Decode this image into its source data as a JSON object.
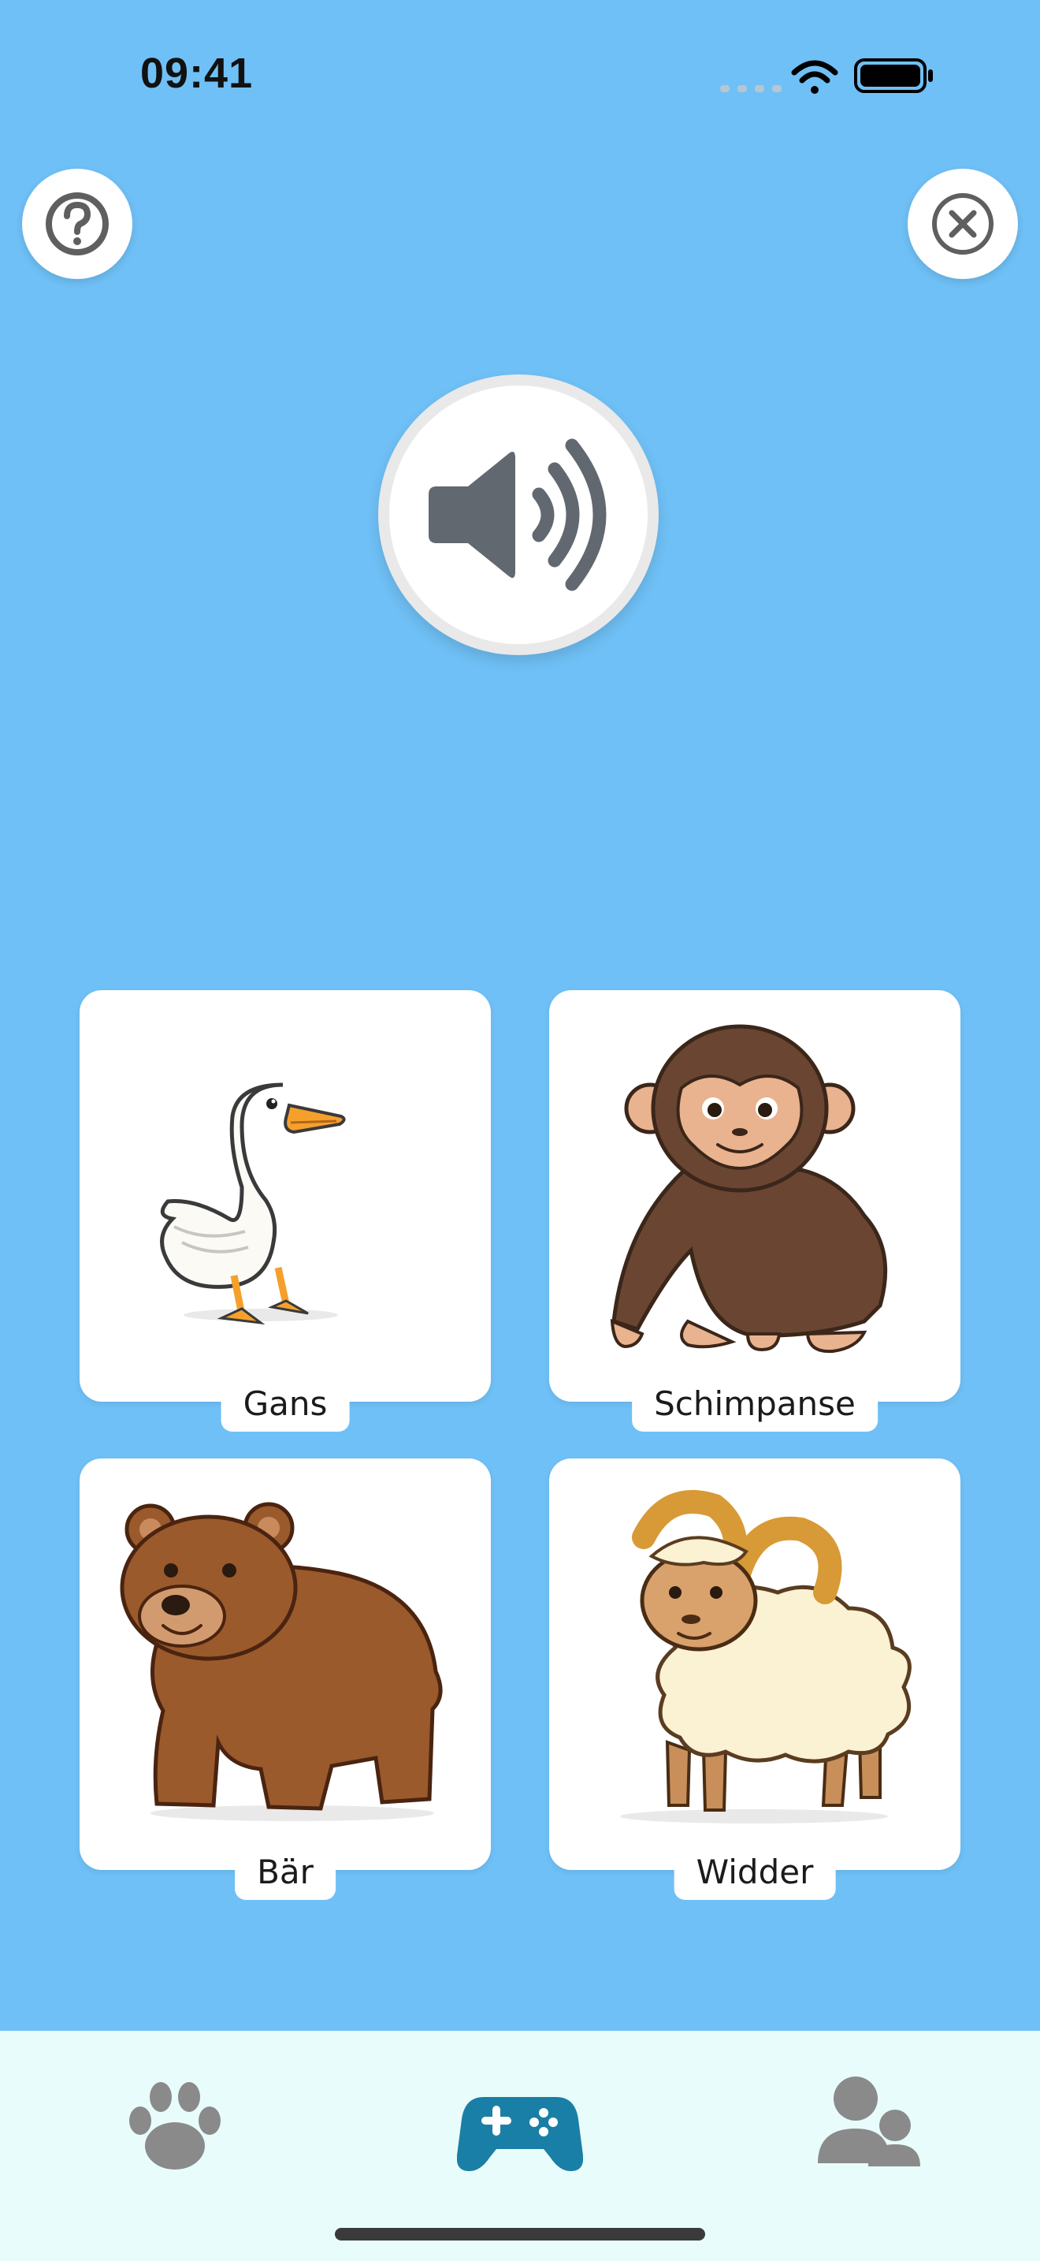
{
  "status_bar": {
    "time": "09:41"
  },
  "header": {
    "help_icon": "question-mark-circle-icon",
    "close_icon": "x-circle-icon"
  },
  "play_sound": {
    "icon": "speaker-wave-icon"
  },
  "answers": [
    {
      "label": "Gans",
      "image": "goose"
    },
    {
      "label": "Schimpanse",
      "image": "chimpanzee"
    },
    {
      "label": "Bär",
      "image": "bear"
    },
    {
      "label": "Widder",
      "image": "ram"
    }
  ],
  "tab_bar": {
    "tabs": [
      {
        "icon": "paw-icon",
        "active": false
      },
      {
        "icon": "gamepad-icon",
        "active": true
      },
      {
        "icon": "users-icon",
        "active": false
      }
    ],
    "active_color": "#1a7fa6",
    "inactive_color": "#8a8a8a"
  },
  "colors": {
    "background": "#6fc0f6",
    "card": "#ffffff",
    "tab_bar": "#e8fcfc"
  }
}
